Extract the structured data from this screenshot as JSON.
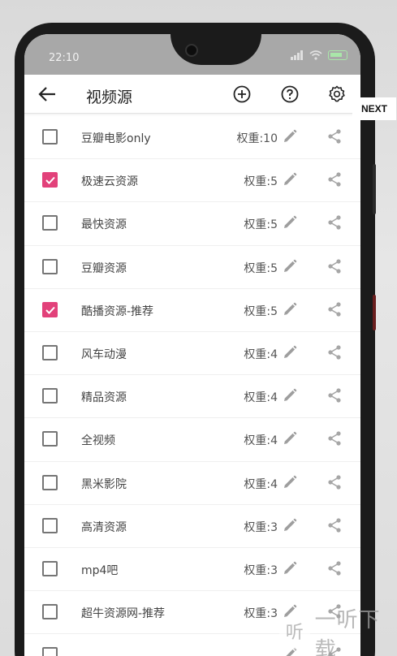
{
  "status_bar": {
    "time": "22:10"
  },
  "app_bar": {
    "title": "视频源",
    "icons": [
      "back-arrow-icon",
      "add-circle-icon",
      "help-circle-icon",
      "settings-gear-icon"
    ]
  },
  "side_label": "NEXT",
  "accent_color": "#e2417a",
  "sources": [
    {
      "name": "豆瓣电影only",
      "weight": "权重:10",
      "checked": false
    },
    {
      "name": "极速云资源",
      "weight": "权重:5",
      "checked": true
    },
    {
      "name": "最快资源",
      "weight": "权重:5",
      "checked": false
    },
    {
      "name": "豆瓣资源",
      "weight": "权重:5",
      "checked": false
    },
    {
      "name": "酷播资源-推荐",
      "weight": "权重:5",
      "checked": true
    },
    {
      "name": "风车动漫",
      "weight": "权重:4",
      "checked": false
    },
    {
      "name": "精品资源",
      "weight": "权重:4",
      "checked": false
    },
    {
      "name": "全视频",
      "weight": "权重:4",
      "checked": false
    },
    {
      "name": "黑米影院",
      "weight": "权重:4",
      "checked": false
    },
    {
      "name": "高清资源",
      "weight": "权重:3",
      "checked": false
    },
    {
      "name": "mp4吧",
      "weight": "权重:3",
      "checked": false
    },
    {
      "name": "超牛资源网-推荐",
      "weight": "权重:3",
      "checked": false
    },
    {
      "name": "",
      "weight": "",
      "checked": false
    }
  ],
  "watermark": {
    "logo_text": "听",
    "text": "一听下载"
  }
}
